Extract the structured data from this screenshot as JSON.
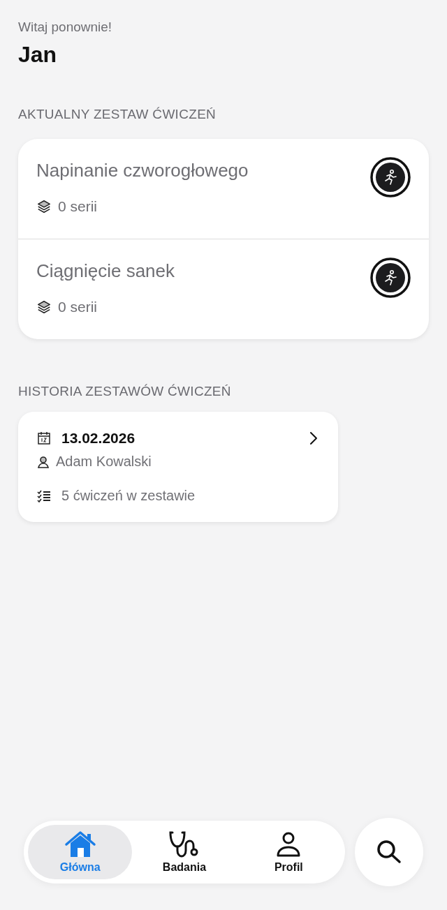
{
  "header": {
    "greeting": "Witaj ponownie!",
    "name": "Jan"
  },
  "current_set": {
    "heading": "AKTUALNY ZESTAW ĆWICZEŃ",
    "exercises": [
      {
        "name": "Napinanie czworogłowego",
        "series": "0 serii"
      },
      {
        "name": "Ciągnięcie sanek",
        "series": "0 serii"
      }
    ]
  },
  "history": {
    "heading": "HISTORIA ZESTAWÓW ĆWICZEŃ",
    "sets": [
      {
        "date": "13.02.2026",
        "person": "Adam Kowalski",
        "count": "5 ćwiczeń w zestawie"
      }
    ]
  },
  "tab_bar": {
    "tabs": [
      {
        "kind": "home",
        "label": "Główna",
        "selected": true
      },
      {
        "kind": "exams",
        "label": "Badania",
        "selected": false
      },
      {
        "kind": "profile",
        "label": "Profil",
        "selected": false
      }
    ]
  }
}
